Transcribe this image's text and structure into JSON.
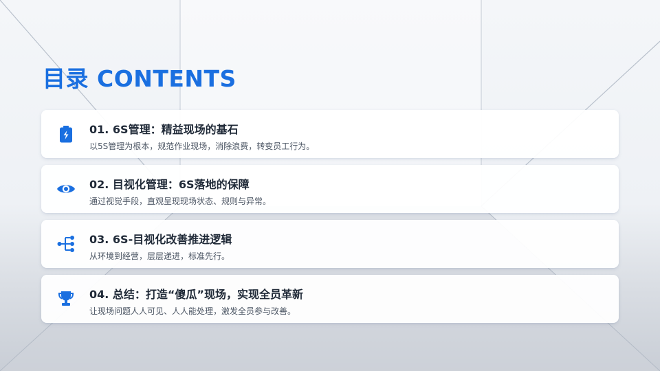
{
  "title": "目录 CONTENTS",
  "colors": {
    "accent": "#1a6fe0",
    "heading": "#1f2937",
    "text": "#4b5563"
  },
  "items": [
    {
      "icon": "battery-charging-icon",
      "heading": "01. 6S管理：精益现场的基石",
      "desc": "以5S管理为根本，规范作业现场，消除浪费，转变员工行为。"
    },
    {
      "icon": "eye-icon",
      "heading": "02. 目视化管理：6S落地的保障",
      "desc": "通过视觉手段，直观呈现现场状态、规则与异常。"
    },
    {
      "icon": "flow-tree-icon",
      "heading": "03. 6S-目视化改善推进逻辑",
      "desc": "从环境到经营，层层递进，标准先行。"
    },
    {
      "icon": "trophy-icon",
      "heading": "04. 总结：打造“傻瓜”现场，实现全员革新",
      "desc": "让现场问题人人可见、人人能处理，激发全员参与改善。"
    }
  ]
}
